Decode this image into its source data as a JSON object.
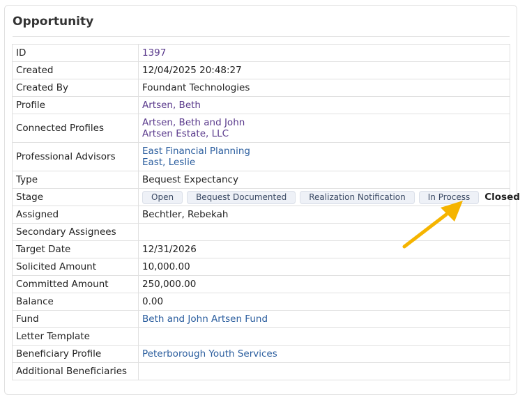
{
  "panel": {
    "title": "Opportunity"
  },
  "fields": {
    "id": {
      "label": "ID",
      "value": "1397"
    },
    "created": {
      "label": "Created",
      "value": "12/04/2025 20:48:27"
    },
    "created_by": {
      "label": "Created By",
      "value": "Foundant Technologies"
    },
    "profile": {
      "label": "Profile",
      "value": "Artsen, Beth"
    },
    "connected_profiles": {
      "label": "Connected Profiles",
      "values": [
        "Artsen, Beth and John",
        "Artsen Estate, LLC"
      ]
    },
    "professional_advisors": {
      "label": "Professional Advisors",
      "values": [
        "East Financial Planning",
        "East, Leslie"
      ]
    },
    "type": {
      "label": "Type",
      "value": "Bequest Expectancy"
    },
    "stage": {
      "label": "Stage",
      "options": [
        "Open",
        "Bequest Documented",
        "Realization Notification",
        "In Process"
      ],
      "current": "Closed"
    },
    "assigned": {
      "label": "Assigned",
      "value": "Bechtler, Rebekah"
    },
    "secondary_assignees": {
      "label": "Secondary Assignees",
      "value": ""
    },
    "target_date": {
      "label": "Target Date",
      "value": "12/31/2026"
    },
    "solicited_amount": {
      "label": "Solicited Amount",
      "value": "10,000.00"
    },
    "committed_amount": {
      "label": "Committed Amount",
      "value": "250,000.00"
    },
    "balance": {
      "label": "Balance",
      "value": "0.00"
    },
    "fund": {
      "label": "Fund",
      "value": "Beth and John Artsen Fund"
    },
    "letter_template": {
      "label": "Letter Template",
      "value": ""
    },
    "beneficiary_profile": {
      "label": "Beneficiary Profile",
      "value": "Peterborough Youth Services"
    },
    "additional_beneficiaries": {
      "label": "Additional Beneficiaries",
      "value": ""
    }
  },
  "colors": {
    "link": "#2a5d9e",
    "visited_link": "#5a3a8c",
    "annotation_arrow": "#f5b400",
    "pill_bg": "#eef1f7"
  },
  "annotation": {
    "icon": "arrow-annotation-icon"
  }
}
